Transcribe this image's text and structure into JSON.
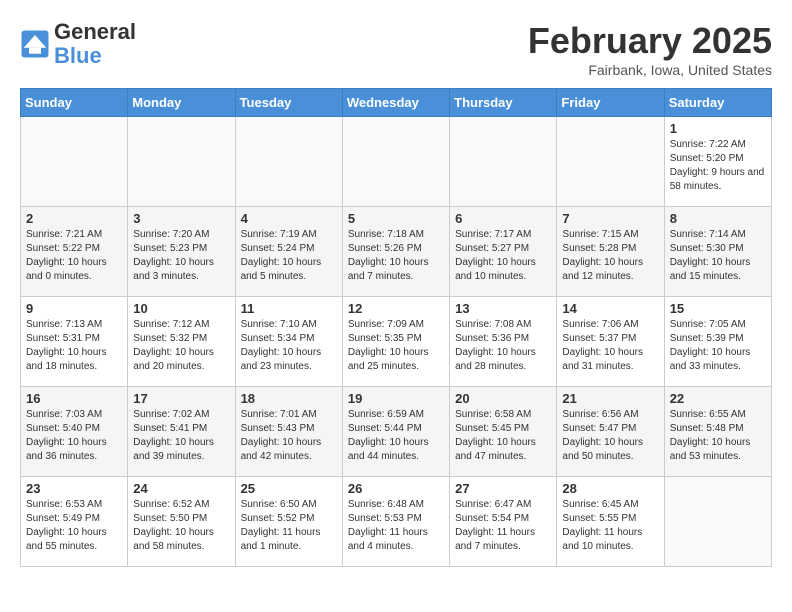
{
  "header": {
    "logo_line1": "General",
    "logo_line2": "Blue",
    "month": "February 2025",
    "location": "Fairbank, Iowa, United States"
  },
  "weekdays": [
    "Sunday",
    "Monday",
    "Tuesday",
    "Wednesday",
    "Thursday",
    "Friday",
    "Saturday"
  ],
  "weeks": [
    [
      {
        "day": "",
        "info": ""
      },
      {
        "day": "",
        "info": ""
      },
      {
        "day": "",
        "info": ""
      },
      {
        "day": "",
        "info": ""
      },
      {
        "day": "",
        "info": ""
      },
      {
        "day": "",
        "info": ""
      },
      {
        "day": "1",
        "info": "Sunrise: 7:22 AM\nSunset: 5:20 PM\nDaylight: 9 hours and 58 minutes."
      }
    ],
    [
      {
        "day": "2",
        "info": "Sunrise: 7:21 AM\nSunset: 5:22 PM\nDaylight: 10 hours and 0 minutes."
      },
      {
        "day": "3",
        "info": "Sunrise: 7:20 AM\nSunset: 5:23 PM\nDaylight: 10 hours and 3 minutes."
      },
      {
        "day": "4",
        "info": "Sunrise: 7:19 AM\nSunset: 5:24 PM\nDaylight: 10 hours and 5 minutes."
      },
      {
        "day": "5",
        "info": "Sunrise: 7:18 AM\nSunset: 5:26 PM\nDaylight: 10 hours and 7 minutes."
      },
      {
        "day": "6",
        "info": "Sunrise: 7:17 AM\nSunset: 5:27 PM\nDaylight: 10 hours and 10 minutes."
      },
      {
        "day": "7",
        "info": "Sunrise: 7:15 AM\nSunset: 5:28 PM\nDaylight: 10 hours and 12 minutes."
      },
      {
        "day": "8",
        "info": "Sunrise: 7:14 AM\nSunset: 5:30 PM\nDaylight: 10 hours and 15 minutes."
      }
    ],
    [
      {
        "day": "9",
        "info": "Sunrise: 7:13 AM\nSunset: 5:31 PM\nDaylight: 10 hours and 18 minutes."
      },
      {
        "day": "10",
        "info": "Sunrise: 7:12 AM\nSunset: 5:32 PM\nDaylight: 10 hours and 20 minutes."
      },
      {
        "day": "11",
        "info": "Sunrise: 7:10 AM\nSunset: 5:34 PM\nDaylight: 10 hours and 23 minutes."
      },
      {
        "day": "12",
        "info": "Sunrise: 7:09 AM\nSunset: 5:35 PM\nDaylight: 10 hours and 25 minutes."
      },
      {
        "day": "13",
        "info": "Sunrise: 7:08 AM\nSunset: 5:36 PM\nDaylight: 10 hours and 28 minutes."
      },
      {
        "day": "14",
        "info": "Sunrise: 7:06 AM\nSunset: 5:37 PM\nDaylight: 10 hours and 31 minutes."
      },
      {
        "day": "15",
        "info": "Sunrise: 7:05 AM\nSunset: 5:39 PM\nDaylight: 10 hours and 33 minutes."
      }
    ],
    [
      {
        "day": "16",
        "info": "Sunrise: 7:03 AM\nSunset: 5:40 PM\nDaylight: 10 hours and 36 minutes."
      },
      {
        "day": "17",
        "info": "Sunrise: 7:02 AM\nSunset: 5:41 PM\nDaylight: 10 hours and 39 minutes."
      },
      {
        "day": "18",
        "info": "Sunrise: 7:01 AM\nSunset: 5:43 PM\nDaylight: 10 hours and 42 minutes."
      },
      {
        "day": "19",
        "info": "Sunrise: 6:59 AM\nSunset: 5:44 PM\nDaylight: 10 hours and 44 minutes."
      },
      {
        "day": "20",
        "info": "Sunrise: 6:58 AM\nSunset: 5:45 PM\nDaylight: 10 hours and 47 minutes."
      },
      {
        "day": "21",
        "info": "Sunrise: 6:56 AM\nSunset: 5:47 PM\nDaylight: 10 hours and 50 minutes."
      },
      {
        "day": "22",
        "info": "Sunrise: 6:55 AM\nSunset: 5:48 PM\nDaylight: 10 hours and 53 minutes."
      }
    ],
    [
      {
        "day": "23",
        "info": "Sunrise: 6:53 AM\nSunset: 5:49 PM\nDaylight: 10 hours and 55 minutes."
      },
      {
        "day": "24",
        "info": "Sunrise: 6:52 AM\nSunset: 5:50 PM\nDaylight: 10 hours and 58 minutes."
      },
      {
        "day": "25",
        "info": "Sunrise: 6:50 AM\nSunset: 5:52 PM\nDaylight: 11 hours and 1 minute."
      },
      {
        "day": "26",
        "info": "Sunrise: 6:48 AM\nSunset: 5:53 PM\nDaylight: 11 hours and 4 minutes."
      },
      {
        "day": "27",
        "info": "Sunrise: 6:47 AM\nSunset: 5:54 PM\nDaylight: 11 hours and 7 minutes."
      },
      {
        "day": "28",
        "info": "Sunrise: 6:45 AM\nSunset: 5:55 PM\nDaylight: 11 hours and 10 minutes."
      },
      {
        "day": "",
        "info": ""
      }
    ]
  ]
}
